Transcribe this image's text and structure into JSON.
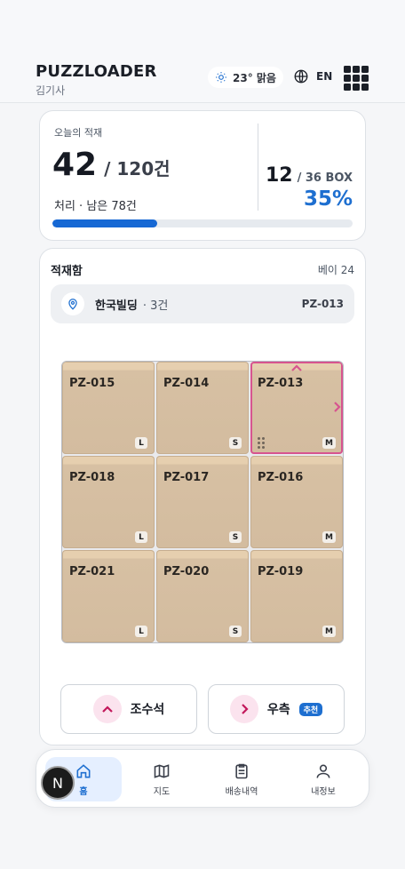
{
  "header": {
    "app_title": "PUZZLOADER",
    "user_name": "김기사",
    "weather_text": "23° 맑음",
    "lang_label": "EN",
    "icons": {
      "weather": "sun-icon",
      "language": "globe-icon",
      "menu": "apps-grid-icon"
    }
  },
  "today": {
    "label": "오늘의 적재",
    "loaded_count": "42",
    "total_label": "/ 120건",
    "processed_label": "처리 · 남은 78건",
    "box_count": "12",
    "box_total_label": "/ 36 BOX",
    "percent_label": "35%",
    "progress_fraction": 0.35
  },
  "stow": {
    "title": "적재함",
    "bay_label": "베이 24",
    "destination": {
      "name": "한국빌딩",
      "count_label": "· 3건",
      "code": "PZ-013",
      "icon": "location-pin-icon"
    },
    "rack": [
      [
        {
          "code": "PZ-015",
          "size": "L"
        },
        {
          "code": "PZ-014",
          "size": "S"
        },
        {
          "code": "PZ-013",
          "size": "M",
          "active": true
        }
      ],
      [
        {
          "code": "PZ-018",
          "size": "L"
        },
        {
          "code": "PZ-017",
          "size": "S"
        },
        {
          "code": "PZ-016",
          "size": "M"
        }
      ],
      [
        {
          "code": "PZ-021",
          "size": "L"
        },
        {
          "code": "PZ-020",
          "size": "S"
        },
        {
          "code": "PZ-019",
          "size": "M"
        }
      ]
    ],
    "actions": {
      "left_label": "조수석",
      "right_label": "우측",
      "right_badge": "추천"
    }
  },
  "tabbar": {
    "items": [
      {
        "label": "홈",
        "icon": "home-icon",
        "active": true
      },
      {
        "label": "지도",
        "icon": "map-icon"
      },
      {
        "label": "배송내역",
        "icon": "clipboard-icon"
      },
      {
        "label": "내정보",
        "icon": "user-icon"
      }
    ]
  },
  "fab_label": "N",
  "colors": {
    "accent": "#1e6fd0",
    "highlight": "#d7548f",
    "box": "#d3bc9f"
  }
}
